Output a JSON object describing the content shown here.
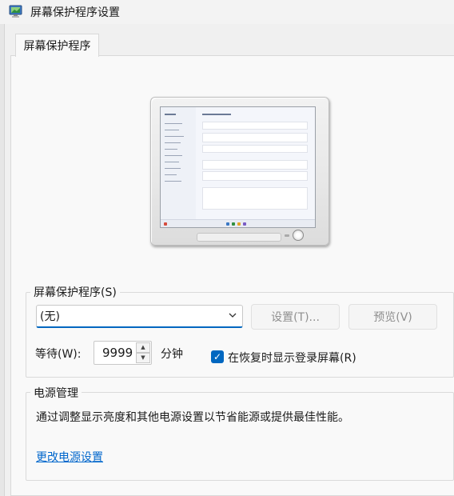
{
  "window": {
    "title": "屏幕保护程序设置",
    "icon": "screensaver-app-icon"
  },
  "tabs": [
    {
      "label": "屏幕保护程序",
      "selected": true
    }
  ],
  "screensaver": {
    "group_label": "屏幕保护程序(S)",
    "selected_option": "(无)",
    "settings_label": "设置(T)...",
    "preview_label": "预览(V)",
    "wait_label": "等待(W):",
    "wait_value": "9999",
    "minutes_label": "分钟",
    "resume_checkbox_label": "在恢复时显示登录屏幕(R)",
    "resume_checked": true
  },
  "power": {
    "group_label": "电源管理",
    "description": "通过调整显示亮度和其他电源设置以节省能源或提供最佳性能。",
    "link_label": "更改电源设置"
  },
  "colors": {
    "accent": "#0067c0",
    "link": "#0066cc"
  }
}
